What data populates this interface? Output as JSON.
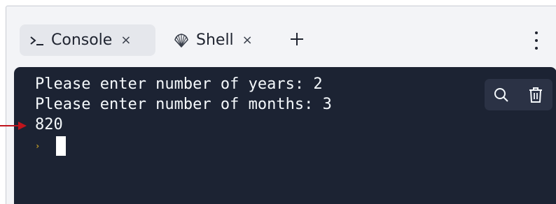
{
  "tabs": [
    {
      "label": "Console",
      "icon": "console-prompt-icon",
      "active": true,
      "close": "×"
    },
    {
      "label": "Shell",
      "icon": "shell-icon",
      "active": false,
      "close": "×"
    }
  ],
  "add_tab_icon": "plus-icon",
  "menu_icon": "more-vertical-icon",
  "console": {
    "output_lines": [
      "Please enter number of years: 2",
      "Please enter number of months: 3",
      "820"
    ],
    "prompt_symbol": "›",
    "tools": [
      {
        "name": "search-icon"
      },
      {
        "name": "trash-icon"
      }
    ]
  },
  "colors": {
    "panel_bg": "#f3f4f7",
    "active_tab_bg": "#e5e7ec",
    "console_bg": "#1c2333",
    "console_text": "#f5f9fc",
    "prompt": "#c9a227",
    "annotation_arrow": "#c0141c"
  }
}
